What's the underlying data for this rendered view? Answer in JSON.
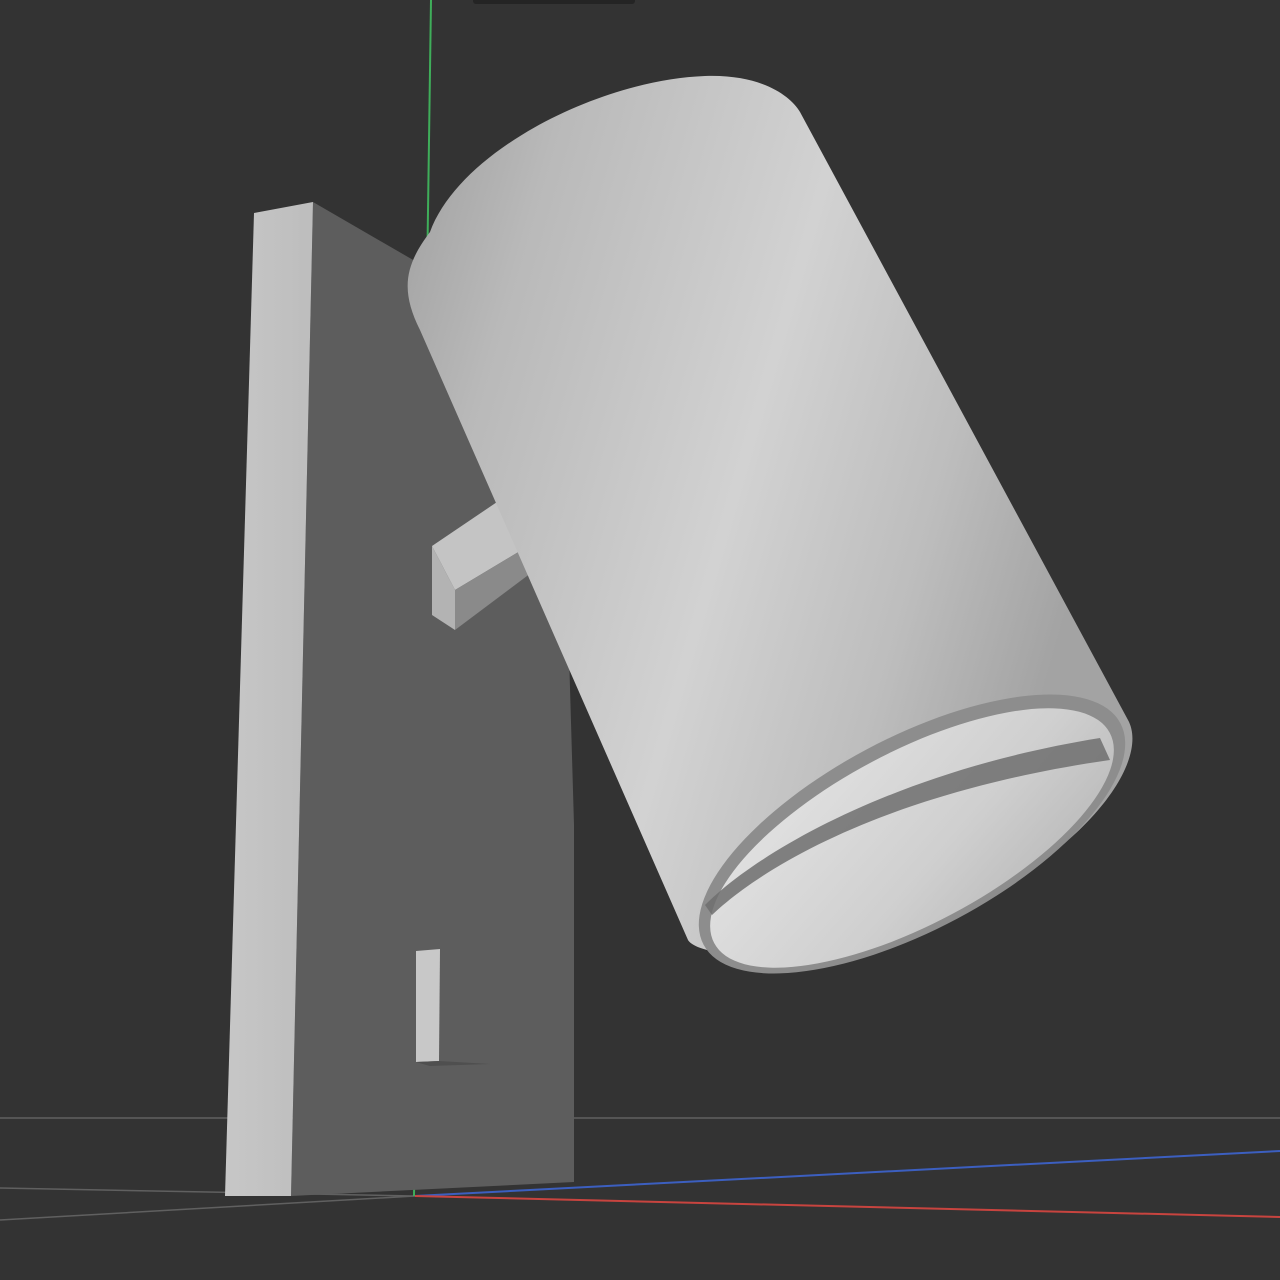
{
  "viewport": {
    "background": "#333333",
    "axis_colors": {
      "x": "#c8443f",
      "y": "#3fae5a",
      "z": "#3c5fc0"
    },
    "grid_color": "#555555"
  },
  "model": {
    "name": "",
    "parts": [
      "wall-plate",
      "arm-bracket",
      "cylinder-shade",
      "switch-slot"
    ],
    "material_color": "#c9c9c9"
  }
}
